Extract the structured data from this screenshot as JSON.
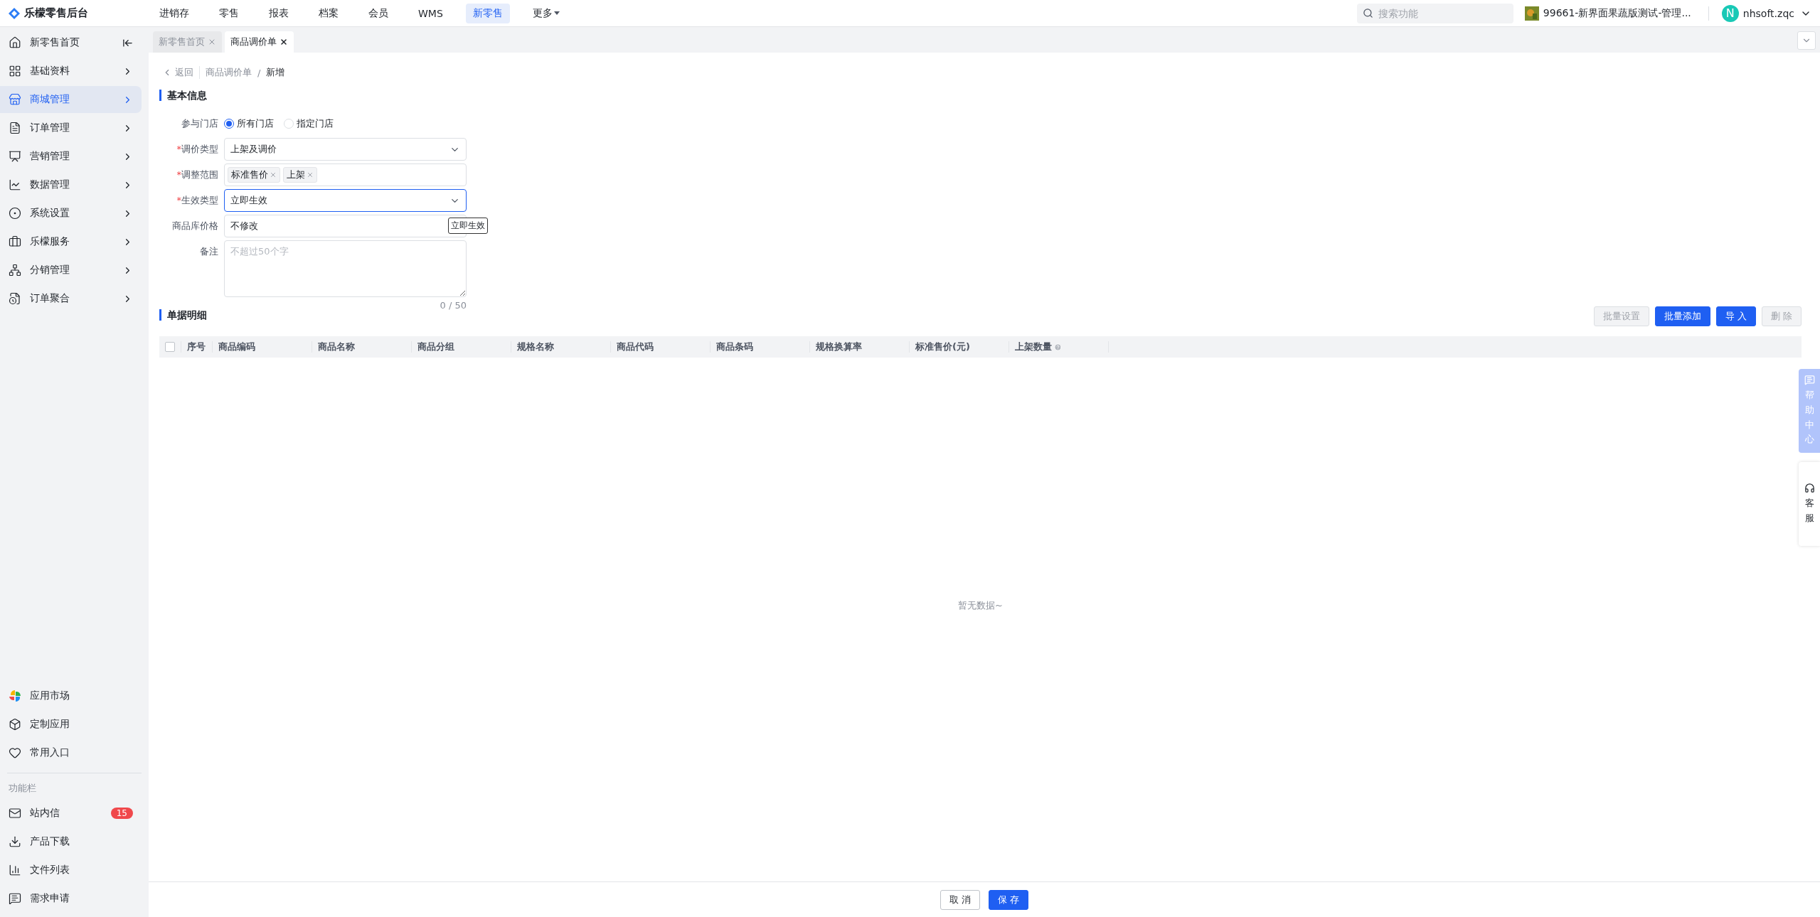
{
  "app": {
    "logo_text": "乐檬零售后台"
  },
  "top_nav": [
    {
      "label": "进销存",
      "selected": false,
      "has_menu": false
    },
    {
      "label": "零售",
      "selected": false,
      "has_menu": false
    },
    {
      "label": "报表",
      "selected": false,
      "has_menu": false
    },
    {
      "label": "档案",
      "selected": false,
      "has_menu": false
    },
    {
      "label": "会员",
      "selected": false,
      "has_menu": false
    },
    {
      "label": "WMS",
      "selected": false,
      "has_menu": false
    },
    {
      "label": "新零售",
      "selected": true,
      "has_menu": false
    },
    {
      "label": "更多",
      "selected": false,
      "has_menu": true
    }
  ],
  "search": {
    "placeholder": "搜索功能"
  },
  "store": {
    "name": "99661-新界面果蔬版测试-管理..."
  },
  "user": {
    "avatar_letter": "N",
    "name": "nhsoft.zqc"
  },
  "sidebar": {
    "menu": [
      {
        "label": "新零售首页",
        "kind": "home",
        "selected": false
      },
      {
        "label": "基础资料",
        "kind": "group",
        "selected": false
      },
      {
        "label": "商城管理",
        "kind": "group",
        "selected": true
      },
      {
        "label": "订单管理",
        "kind": "group",
        "selected": false
      },
      {
        "label": "营销管理",
        "kind": "group",
        "selected": false
      },
      {
        "label": "数据管理",
        "kind": "group",
        "selected": false
      },
      {
        "label": "系统设置",
        "kind": "group",
        "selected": false
      },
      {
        "label": "乐檬服务",
        "kind": "group",
        "selected": false
      },
      {
        "label": "分销管理",
        "kind": "group",
        "selected": false
      },
      {
        "label": "订单聚合",
        "kind": "group",
        "selected": false
      }
    ],
    "apps": [
      {
        "label": "应用市场"
      },
      {
        "label": "定制应用"
      },
      {
        "label": "常用入口"
      }
    ],
    "function_bar": {
      "title": "功能栏",
      "items": [
        {
          "label": "站内信",
          "badge": "15"
        },
        {
          "label": "产品下载"
        },
        {
          "label": "文件列表"
        },
        {
          "label": "需求申请"
        }
      ]
    }
  },
  "page_tabs": [
    {
      "label": "新零售首页",
      "selected": false
    },
    {
      "label": "商品调价单",
      "selected": true
    }
  ],
  "breadcrumb": {
    "back": "返回",
    "separator": "/",
    "items": [
      "商品调价单",
      "新增"
    ]
  },
  "basic_info": {
    "title": "基本信息",
    "required_mark": "*",
    "fields": [
      {
        "kind": "radio",
        "label": "参与门店",
        "required": false,
        "options": [
          {
            "label": "所有门店",
            "selected": true
          },
          {
            "label": "指定门店",
            "selected": false
          }
        ]
      },
      {
        "kind": "select",
        "label": "调价类型",
        "required": true,
        "focused": false,
        "value": "上架及调价"
      },
      {
        "kind": "tags",
        "label": "调整范围",
        "required": true,
        "focused": false,
        "tags": [
          "标准售价",
          "上架"
        ]
      },
      {
        "kind": "select",
        "label": "生效类型",
        "required": true,
        "focused": true,
        "value": "立即生效"
      },
      {
        "kind": "input",
        "label": "商品库价格",
        "required": false,
        "focused": false,
        "value": "不修改",
        "tooltip": "立即生效"
      },
      {
        "kind": "textarea",
        "label": "备注",
        "required": false,
        "focused": false,
        "placeholder": "不超过50个字",
        "counter": "0 / 50"
      }
    ]
  },
  "details": {
    "title": "单据明细",
    "buttons": [
      {
        "label": "批量设置",
        "kind": "disabled"
      },
      {
        "label": "批量添加",
        "kind": "primary"
      },
      {
        "label": "导 入",
        "kind": "primary"
      },
      {
        "label": "删 除",
        "kind": "disabled"
      }
    ],
    "select_all": {
      "checked": false
    },
    "columns": [
      {
        "label": "序号",
        "help": false
      },
      {
        "label": "商品编码",
        "help": false
      },
      {
        "label": "商品名称",
        "help": false
      },
      {
        "label": "商品分组",
        "help": false
      },
      {
        "label": "规格名称",
        "help": false
      },
      {
        "label": "商品代码",
        "help": false
      },
      {
        "label": "商品条码",
        "help": false
      },
      {
        "label": "规格换算率",
        "help": false
      },
      {
        "label": "标准售价(元)",
        "help": false
      },
      {
        "label": "上架数量",
        "help": true
      }
    ],
    "empty_text": "暂无数据~"
  },
  "footer": {
    "buttons": [
      {
        "label": "取 消",
        "kind": "default"
      },
      {
        "label": "保 存",
        "kind": "primary"
      }
    ]
  },
  "help_dock": [
    {
      "label": "帮助中心",
      "kind": "help"
    },
    {
      "label": "客服",
      "kind": "service"
    }
  ]
}
